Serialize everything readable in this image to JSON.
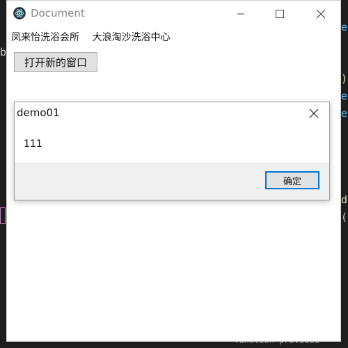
{
  "window": {
    "title": "Document",
    "icon": "electron-icon"
  },
  "links": [
    "凤来怡洗浴会所",
    "大浪淘沙洗浴中心"
  ],
  "open_button_label": "打开新的窗口",
  "dialog": {
    "title": "demo01",
    "message": "111",
    "ok_label": "确定"
  },
  "background_editor": {
    "fragments": [
      "e",
      "b",
      ")",
      "e",
      "e",
      "d",
      "(",
      "function provided"
    ]
  },
  "colors": {
    "editor_bg": "#1e1e1e",
    "window_bg": "#ffffff",
    "dialog_footer": "#f0f0f0",
    "focus_border": "#0078d7",
    "app_icon": "#47848f"
  }
}
